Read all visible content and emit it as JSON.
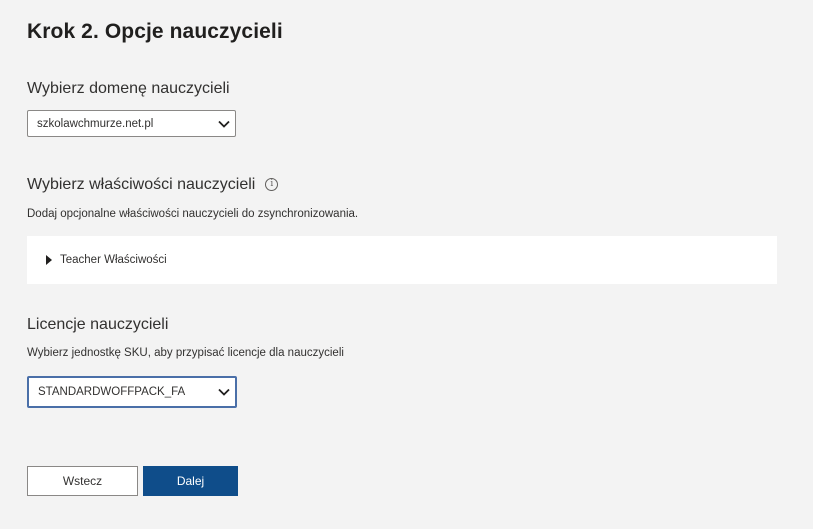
{
  "step": {
    "title": "Krok 2. Opcje nauczycieli"
  },
  "domain": {
    "label": "Wybierz domenę nauczycieli",
    "selected": "szkolawchmurze.net.pl"
  },
  "properties": {
    "label": "Wybierz właściwości nauczycieli",
    "info_icon": "info-icon",
    "description": "Dodaj opcjonalne właściwości nauczycieli do zsynchronizowania.",
    "expander_label": "Teacher Właściwości"
  },
  "licenses": {
    "label": "Licencje nauczycieli",
    "description": "Wybierz jednostkę SKU, aby przypisać licencje dla nauczycieli",
    "selected": "STANDARDWOFFPACK_FA"
  },
  "buttons": {
    "back": "Wstecz",
    "next": "Dalej"
  },
  "colors": {
    "background": "#f3f3f3",
    "primary_button": "#0f4d8a"
  }
}
